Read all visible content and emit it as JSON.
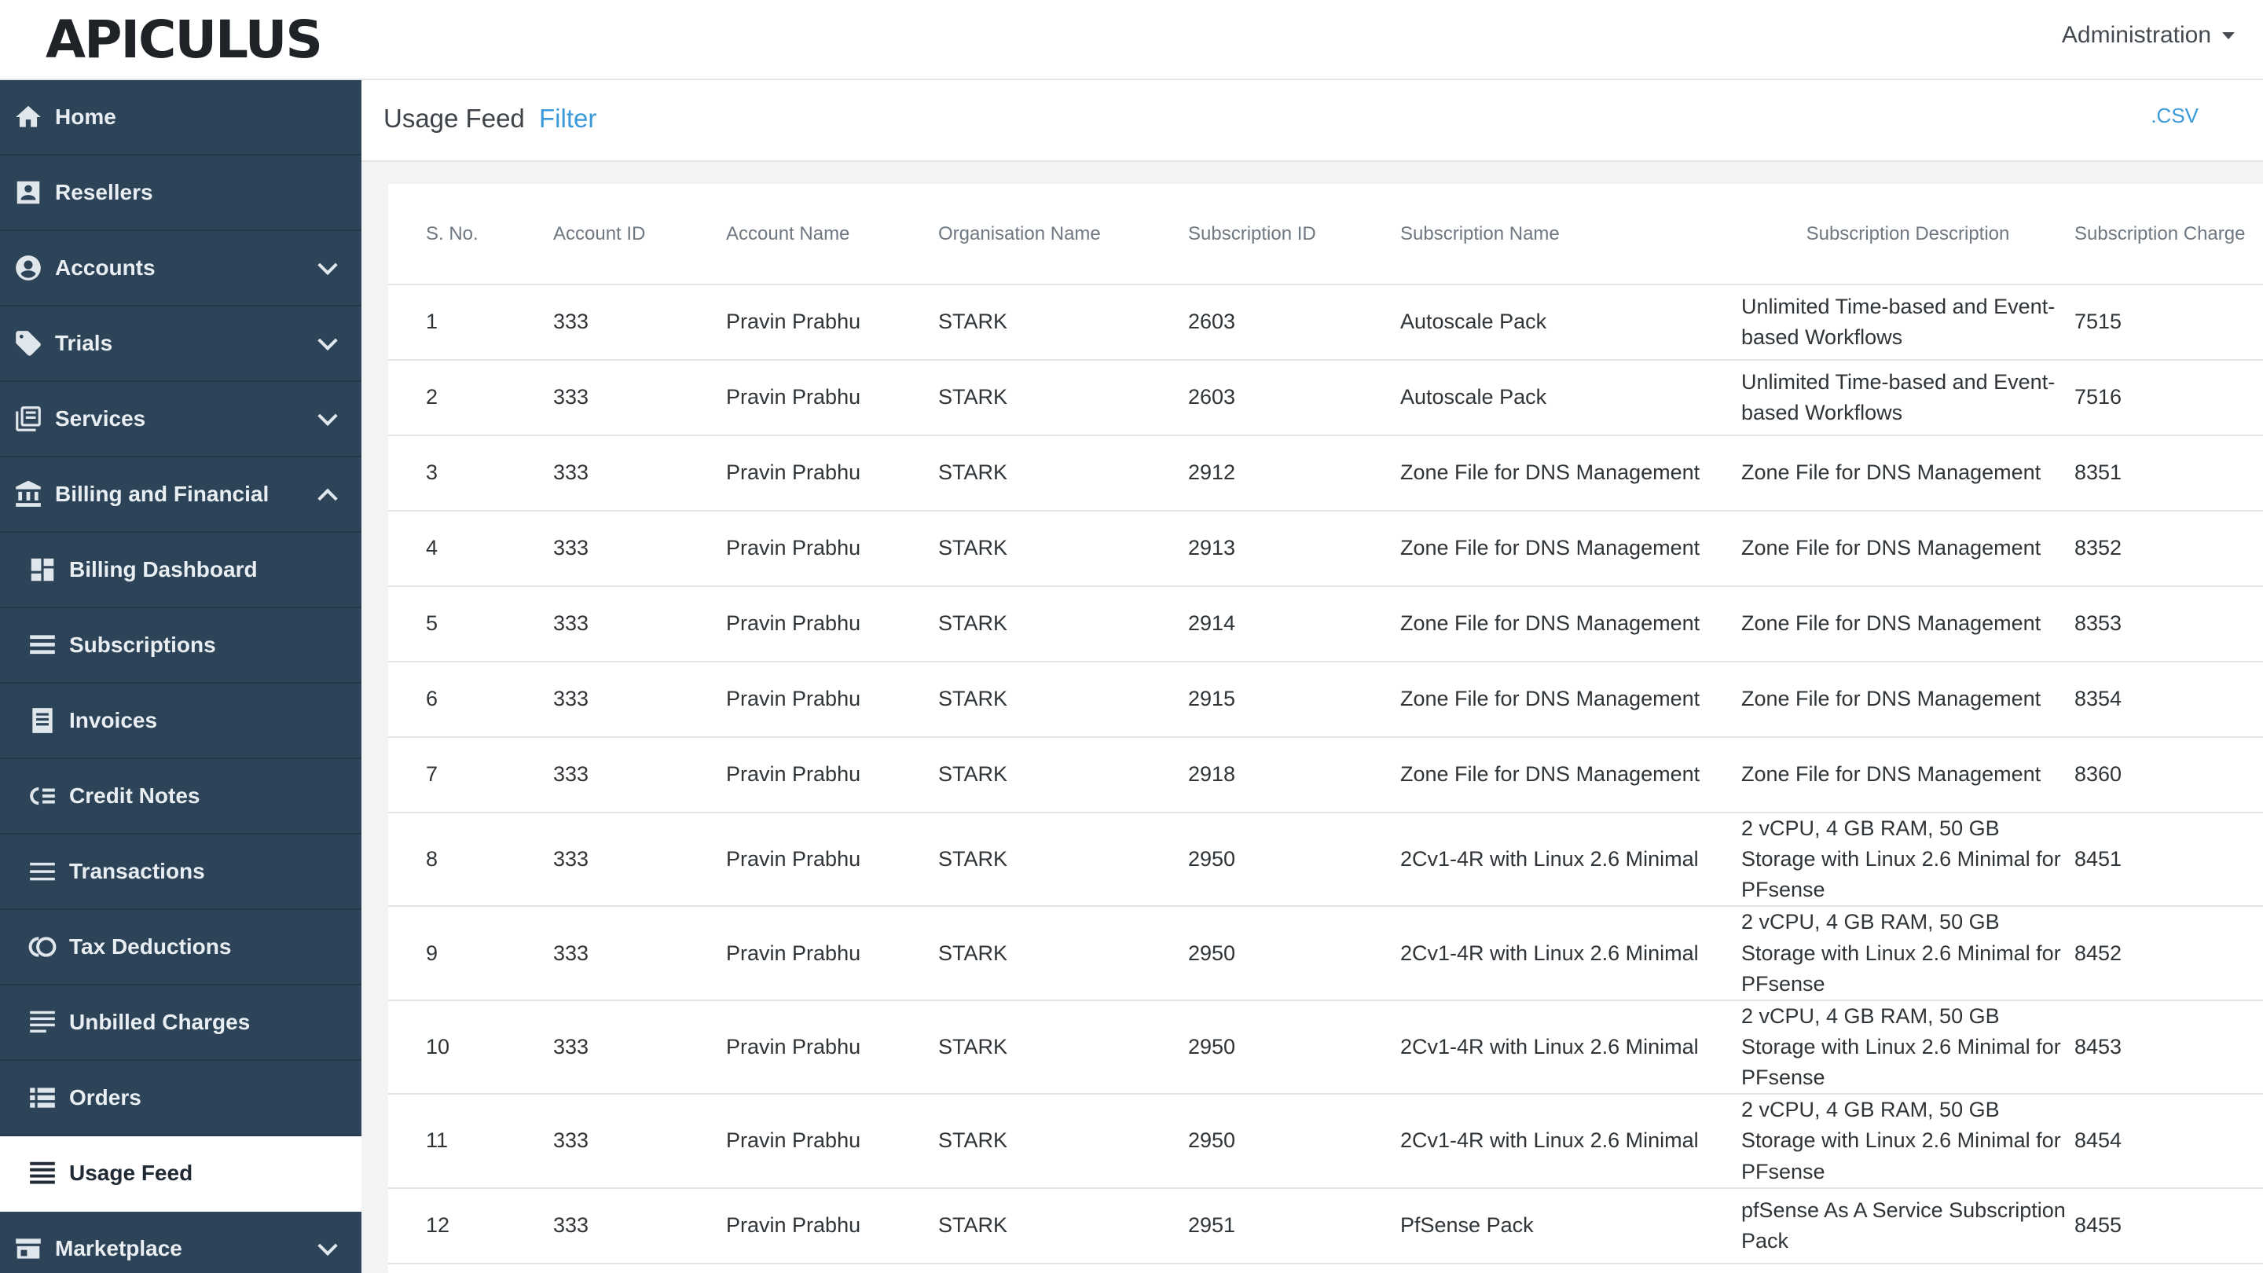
{
  "app": {
    "logo_text": "APICULUS",
    "admin_label": "Administration"
  },
  "sidebar": {
    "items": [
      {
        "label": "Home",
        "icon": "home-icon"
      },
      {
        "label": "Resellers",
        "icon": "user-card-icon"
      },
      {
        "label": "Accounts",
        "icon": "account-circle-icon"
      },
      {
        "label": "Trials",
        "icon": "tag-icon"
      },
      {
        "label": "Services",
        "icon": "library-icon"
      },
      {
        "label": "Billing and Financial",
        "icon": "bank-icon"
      },
      {
        "label": "Billing Dashboard",
        "icon": "dashboard-icon"
      },
      {
        "label": "Subscriptions",
        "icon": "list-icon"
      },
      {
        "label": "Invoices",
        "icon": "receipt-icon"
      },
      {
        "label": "Credit Notes",
        "icon": "credit-note-icon"
      },
      {
        "label": "Transactions",
        "icon": "lines-icon"
      },
      {
        "label": "Tax Deductions",
        "icon": "tax-icon"
      },
      {
        "label": "Unbilled Charges",
        "icon": "notes-icon"
      },
      {
        "label": "Orders",
        "icon": "orders-icon"
      },
      {
        "label": "Usage Feed",
        "icon": "feed-icon"
      },
      {
        "label": "Marketplace",
        "icon": "store-icon"
      }
    ]
  },
  "header": {
    "title": "Usage Feed",
    "filter_label": "Filter",
    "csv_label": ".CSV"
  },
  "table": {
    "columns": [
      "S. No.",
      "Account ID",
      "Account Name",
      "Organisation Name",
      "Subscription ID",
      "Subscription Name",
      "Subscription Description",
      "Subscription Charge"
    ],
    "rows": [
      [
        "1",
        "333",
        "Pravin Prabhu",
        "STARK",
        "2603",
        "Autoscale Pack",
        "Unlimited Time-based and Event-based Workflows",
        "7515"
      ],
      [
        "2",
        "333",
        "Pravin Prabhu",
        "STARK",
        "2603",
        "Autoscale Pack",
        "Unlimited Time-based and Event-based Workflows",
        "7516"
      ],
      [
        "3",
        "333",
        "Pravin Prabhu",
        "STARK",
        "2912",
        "Zone File for DNS Management",
        "Zone File for DNS Management",
        "8351"
      ],
      [
        "4",
        "333",
        "Pravin Prabhu",
        "STARK",
        "2913",
        "Zone File for DNS Management",
        "Zone File for DNS Management",
        "8352"
      ],
      [
        "5",
        "333",
        "Pravin Prabhu",
        "STARK",
        "2914",
        "Zone File for DNS Management",
        "Zone File for DNS Management",
        "8353"
      ],
      [
        "6",
        "333",
        "Pravin Prabhu",
        "STARK",
        "2915",
        "Zone File for DNS Management",
        "Zone File for DNS Management",
        "8354"
      ],
      [
        "7",
        "333",
        "Pravin Prabhu",
        "STARK",
        "2918",
        "Zone File for DNS Management",
        "Zone File for DNS Management",
        "8360"
      ],
      [
        "8",
        "333",
        "Pravin Prabhu",
        "STARK",
        "2950",
        "2Cv1-4R with Linux 2.6 Minimal",
        "2 vCPU, 4 GB RAM, 50 GB Storage with Linux 2.6 Minimal for PFsense",
        "8451"
      ],
      [
        "9",
        "333",
        "Pravin Prabhu",
        "STARK",
        "2950",
        "2Cv1-4R with Linux 2.6 Minimal",
        "2 vCPU, 4 GB RAM, 50 GB Storage with Linux 2.6 Minimal for PFsense",
        "8452"
      ],
      [
        "10",
        "333",
        "Pravin Prabhu",
        "STARK",
        "2950",
        "2Cv1-4R with Linux 2.6 Minimal",
        "2 vCPU, 4 GB RAM, 50 GB Storage with Linux 2.6 Minimal for PFsense",
        "8453"
      ],
      [
        "11",
        "333",
        "Pravin Prabhu",
        "STARK",
        "2950",
        "2Cv1-4R with Linux 2.6 Minimal",
        "2 vCPU, 4 GB RAM, 50 GB Storage with Linux 2.6 Minimal for PFsense",
        "8454"
      ],
      [
        "12",
        "333",
        "Pravin Prabhu",
        "STARK",
        "2951",
        "PfSense Pack",
        "pfSense As A Service Subscription Pack",
        "8455"
      ]
    ]
  },
  "colors": {
    "sidebar_bg": "#2d4357",
    "link": "#3a9ad9",
    "active_bg": "#ffffff"
  }
}
